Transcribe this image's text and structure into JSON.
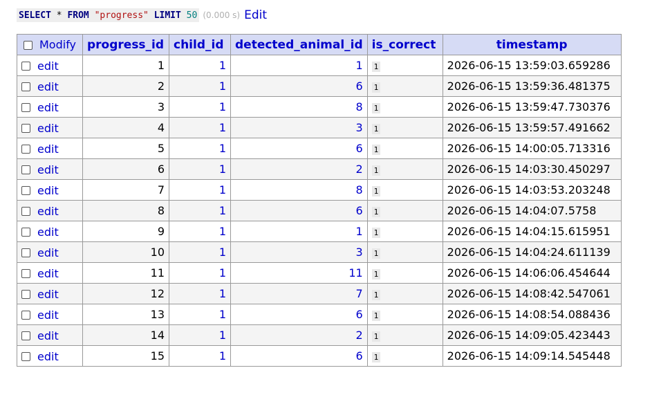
{
  "query": {
    "kw_select": "SELECT",
    "star": "*",
    "kw_from": "FROM",
    "table_name": "\"progress\"",
    "kw_limit": "LIMIT",
    "limit_value": "50",
    "elapsed": "(0.000 s)",
    "edit_label": "Edit"
  },
  "table": {
    "headers": {
      "modify": "Modify",
      "progress_id": "progress_id",
      "child_id": "child_id",
      "detected_animal_id": "detected_animal_id",
      "is_correct": "is_correct",
      "timestamp": "timestamp"
    },
    "row_edit_label": "edit",
    "rows": [
      {
        "progress_id": "1",
        "child_id": "1",
        "detected_animal_id": "1",
        "is_correct": "1",
        "timestamp": "2026-06-15 13:59:03.659286"
      },
      {
        "progress_id": "2",
        "child_id": "1",
        "detected_animal_id": "6",
        "is_correct": "1",
        "timestamp": "2026-06-15 13:59:36.481375"
      },
      {
        "progress_id": "3",
        "child_id": "1",
        "detected_animal_id": "8",
        "is_correct": "1",
        "timestamp": "2026-06-15 13:59:47.730376"
      },
      {
        "progress_id": "4",
        "child_id": "1",
        "detected_animal_id": "3",
        "is_correct": "1",
        "timestamp": "2026-06-15 13:59:57.491662"
      },
      {
        "progress_id": "5",
        "child_id": "1",
        "detected_animal_id": "6",
        "is_correct": "1",
        "timestamp": "2026-06-15 14:00:05.713316"
      },
      {
        "progress_id": "6",
        "child_id": "1",
        "detected_animal_id": "2",
        "is_correct": "1",
        "timestamp": "2026-06-15 14:03:30.450297"
      },
      {
        "progress_id": "7",
        "child_id": "1",
        "detected_animal_id": "8",
        "is_correct": "1",
        "timestamp": "2026-06-15 14:03:53.203248"
      },
      {
        "progress_id": "8",
        "child_id": "1",
        "detected_animal_id": "6",
        "is_correct": "1",
        "timestamp": "2026-06-15 14:04:07.5758"
      },
      {
        "progress_id": "9",
        "child_id": "1",
        "detected_animal_id": "1",
        "is_correct": "1",
        "timestamp": "2026-06-15 14:04:15.615951"
      },
      {
        "progress_id": "10",
        "child_id": "1",
        "detected_animal_id": "3",
        "is_correct": "1",
        "timestamp": "2026-06-15 14:04:24.611139"
      },
      {
        "progress_id": "11",
        "child_id": "1",
        "detected_animal_id": "11",
        "is_correct": "1",
        "timestamp": "2026-06-15 14:06:06.454644"
      },
      {
        "progress_id": "12",
        "child_id": "1",
        "detected_animal_id": "7",
        "is_correct": "1",
        "timestamp": "2026-06-15 14:08:42.547061"
      },
      {
        "progress_id": "13",
        "child_id": "1",
        "detected_animal_id": "6",
        "is_correct": "1",
        "timestamp": "2026-06-15 14:08:54.088436"
      },
      {
        "progress_id": "14",
        "child_id": "1",
        "detected_animal_id": "2",
        "is_correct": "1",
        "timestamp": "2026-06-15 14:09:05.423443"
      },
      {
        "progress_id": "15",
        "child_id": "1",
        "detected_animal_id": "6",
        "is_correct": "1",
        "timestamp": "2026-06-15 14:09:14.545448"
      }
    ]
  },
  "colors": {
    "header_bg": "#d6dbf5",
    "link": "#0000cc",
    "even_row_bg": "#f4f4f4",
    "border": "#999999"
  }
}
